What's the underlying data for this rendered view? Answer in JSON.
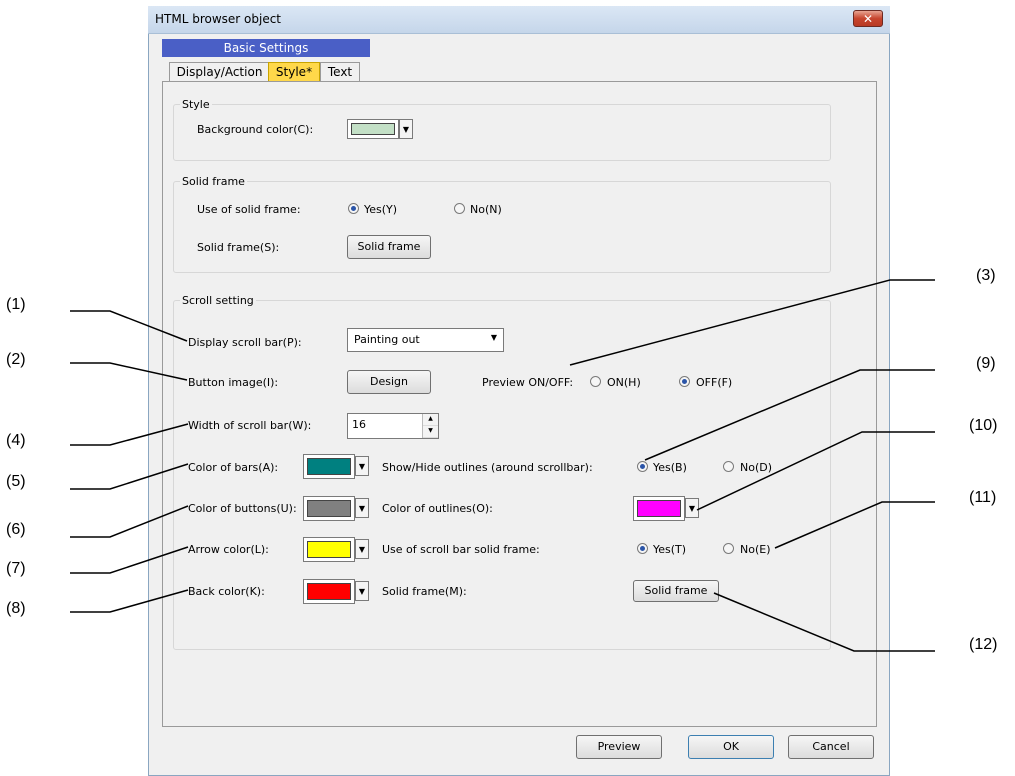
{
  "window": {
    "title": "HTML browser object",
    "close": "✕"
  },
  "tabs": {
    "group_label": "Basic Settings",
    "items": [
      {
        "label": "Display/Action"
      },
      {
        "label": "Style*"
      },
      {
        "label": "Text"
      }
    ]
  },
  "style_group": {
    "title": "Style",
    "background_color_label": "Background color(C):",
    "background_color": "#c3e0c6"
  },
  "solid_frame_group": {
    "title": "Solid frame",
    "use_label": "Use of solid frame:",
    "yes_label": "Yes(Y)",
    "no_label": "No(N)",
    "selected": "yes",
    "frame_label": "Solid frame(S):",
    "frame_button": "Solid frame"
  },
  "scroll_group": {
    "title": "Scroll setting",
    "display_label": "Display scroll bar(P):",
    "display_value": "Painting out",
    "button_image_label": "Button image(I):",
    "design_button": "Design",
    "preview_label": "Preview ON/OFF:",
    "preview_on": "ON(H)",
    "preview_off": "OFF(F)",
    "preview_selected": "off",
    "width_label": "Width of scroll bar(W):",
    "width_value": "16",
    "color_bars_label": "Color of bars(A):",
    "color_bars": "#008080",
    "color_buttons_label": "Color of buttons(U):",
    "color_buttons": "#808080",
    "arrow_color_label": "Arrow color(L):",
    "arrow_color": "#ffff00",
    "back_color_label": "Back color(K):",
    "back_color": "#ff0000",
    "outlines_label": "Show/Hide outlines (around scrollbar):",
    "outlines_yes": "Yes(B)",
    "outlines_no": "No(D)",
    "outline_color_label": "Color of outlines(O):",
    "outline_color": "#ff00ff",
    "sb_frame_label": "Use of scroll bar solid frame:",
    "sb_frame_yes": "Yes(T)",
    "sb_frame_no": "No(E)",
    "sb_solid_frame_label": "Solid frame(M):",
    "sb_solid_frame_button": "Solid frame"
  },
  "footer": {
    "preview": "Preview",
    "ok": "OK",
    "cancel": "Cancel"
  },
  "callouts": [
    "(1)",
    "(2)",
    "(3)",
    "(4)",
    "(5)",
    "(6)",
    "(7)",
    "(8)",
    "(9)",
    "(10)",
    "(11)",
    "(12)"
  ]
}
